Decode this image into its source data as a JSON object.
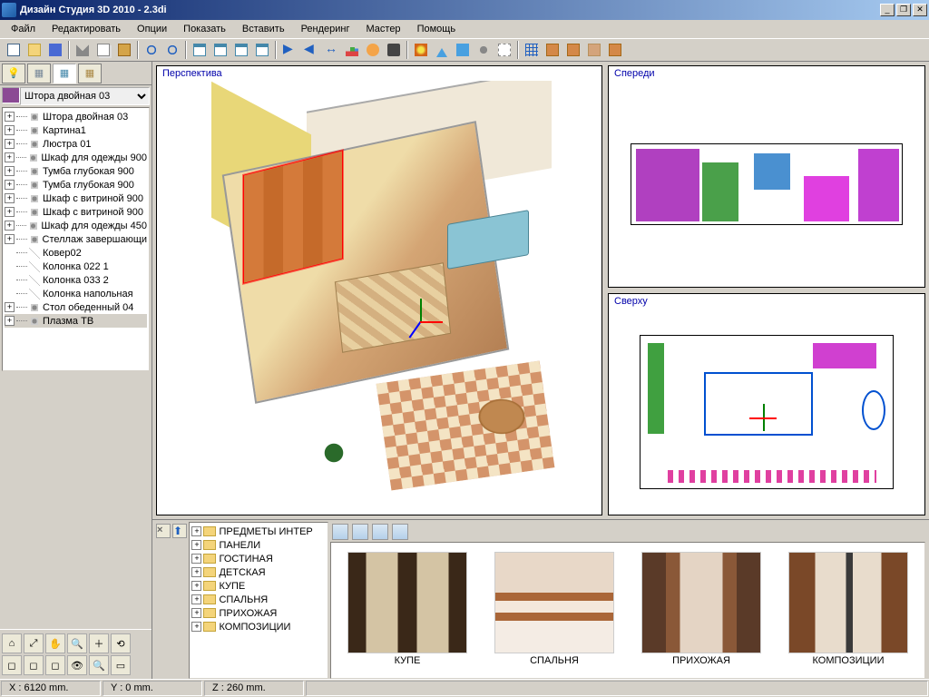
{
  "title": "Дизайн Студия 3D 2010 - 2.3di",
  "menu": [
    "Файл",
    "Редактировать",
    "Опции",
    "Показать",
    "Вставить",
    "Рендеринг",
    "Мастер",
    "Помощь"
  ],
  "selector": {
    "current": "Штора двойная 03"
  },
  "tree": [
    {
      "exp": "+",
      "t": "obj",
      "label": "Штора двойная 03"
    },
    {
      "exp": "+",
      "t": "obj",
      "label": "Картина1"
    },
    {
      "exp": "+",
      "t": "obj",
      "label": "Люстра 01"
    },
    {
      "exp": "+",
      "t": "obj",
      "label": "Шкаф для одежды 900"
    },
    {
      "exp": "+",
      "t": "obj",
      "label": "Тумба глубокая 900"
    },
    {
      "exp": "+",
      "t": "obj",
      "label": "Тумба глубокая 900"
    },
    {
      "exp": "+",
      "t": "obj",
      "label": "Шкаф с витриной 900"
    },
    {
      "exp": "+",
      "t": "obj",
      "label": "Шкаф с витриной 900"
    },
    {
      "exp": "+",
      "t": "obj",
      "label": "Шкаф для одежды 450"
    },
    {
      "exp": "+",
      "t": "obj",
      "label": "Стеллаж завершающи"
    },
    {
      "exp": "",
      "t": "leaf",
      "label": "Ковер02"
    },
    {
      "exp": "",
      "t": "leaf",
      "label": "Колонка 022 1"
    },
    {
      "exp": "",
      "t": "leaf",
      "label": "Колонка 033 2"
    },
    {
      "exp": "",
      "t": "leaf",
      "label": "Колонка напольная"
    },
    {
      "exp": "+",
      "t": "obj",
      "label": "Стол обеденный 04"
    },
    {
      "exp": "+",
      "t": "obj",
      "label": "Плазма ТВ",
      "sel": true
    }
  ],
  "views": {
    "persp": "Перспектива",
    "front": "Спереди",
    "top": "Сверху"
  },
  "library": {
    "categories": [
      "ПРЕДМЕТЫ ИНТЕР",
      "ПАНЕЛИ",
      "ГОСТИНАЯ",
      "ДЕТСКАЯ",
      "КУПЕ",
      "СПАЛЬНЯ",
      "ПРИХОЖАЯ",
      "КОМПОЗИЦИИ"
    ],
    "thumbs": [
      {
        "cap": "КУПЕ"
      },
      {
        "cap": "СПАЛЬНЯ"
      },
      {
        "cap": "ПРИХОЖАЯ"
      },
      {
        "cap": "КОМПОЗИЦИИ"
      }
    ]
  },
  "status": {
    "x": "X : 6120 mm.",
    "y": "Y : 0 mm.",
    "z": "Z : 260 mm."
  }
}
